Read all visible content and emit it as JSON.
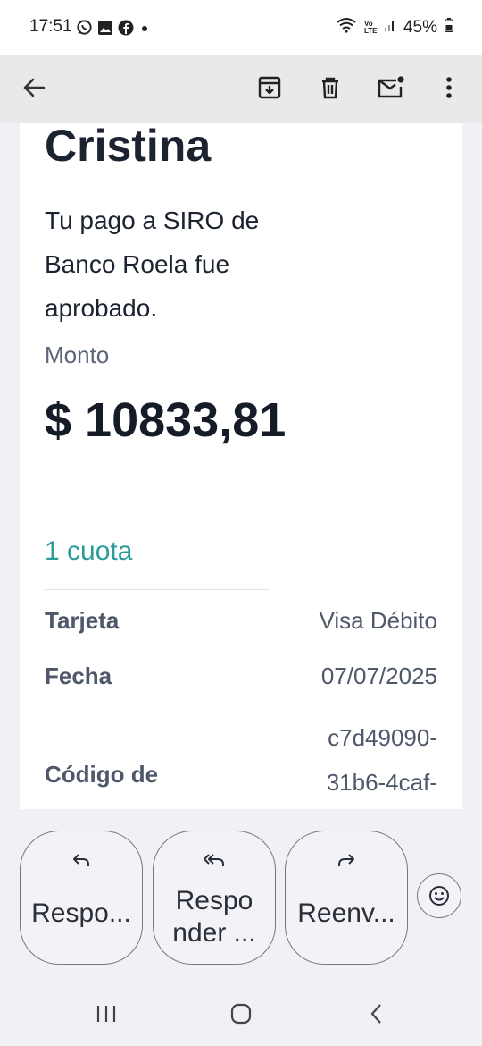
{
  "status_bar": {
    "time": "17:51",
    "battery": "45%",
    "network_label": "Vo LTE"
  },
  "email": {
    "greeting_name": "Cristina",
    "message": "Tu pago a SIRO de Banco Roela fue aprobado.",
    "amount_label": "Monto",
    "amount_value": "$ 10833,81",
    "installments": "1 cuota",
    "details": [
      {
        "label": "Tarjeta",
        "value": "Visa Débito"
      },
      {
        "label": "Fecha",
        "value": "07/07/2025"
      },
      {
        "label": "Código de",
        "value": "c7d49090-31b6-4caf-"
      }
    ]
  },
  "actions": {
    "reply_label": "Respo...",
    "reply_all_label": "Respo nder ...",
    "forward_label": "Reenv..."
  },
  "colors": {
    "accent_teal": "#2a9d9a",
    "text_dark": "#1b2230",
    "text_muted": "#4f586b",
    "app_bar_bg": "#e9e9ec"
  }
}
